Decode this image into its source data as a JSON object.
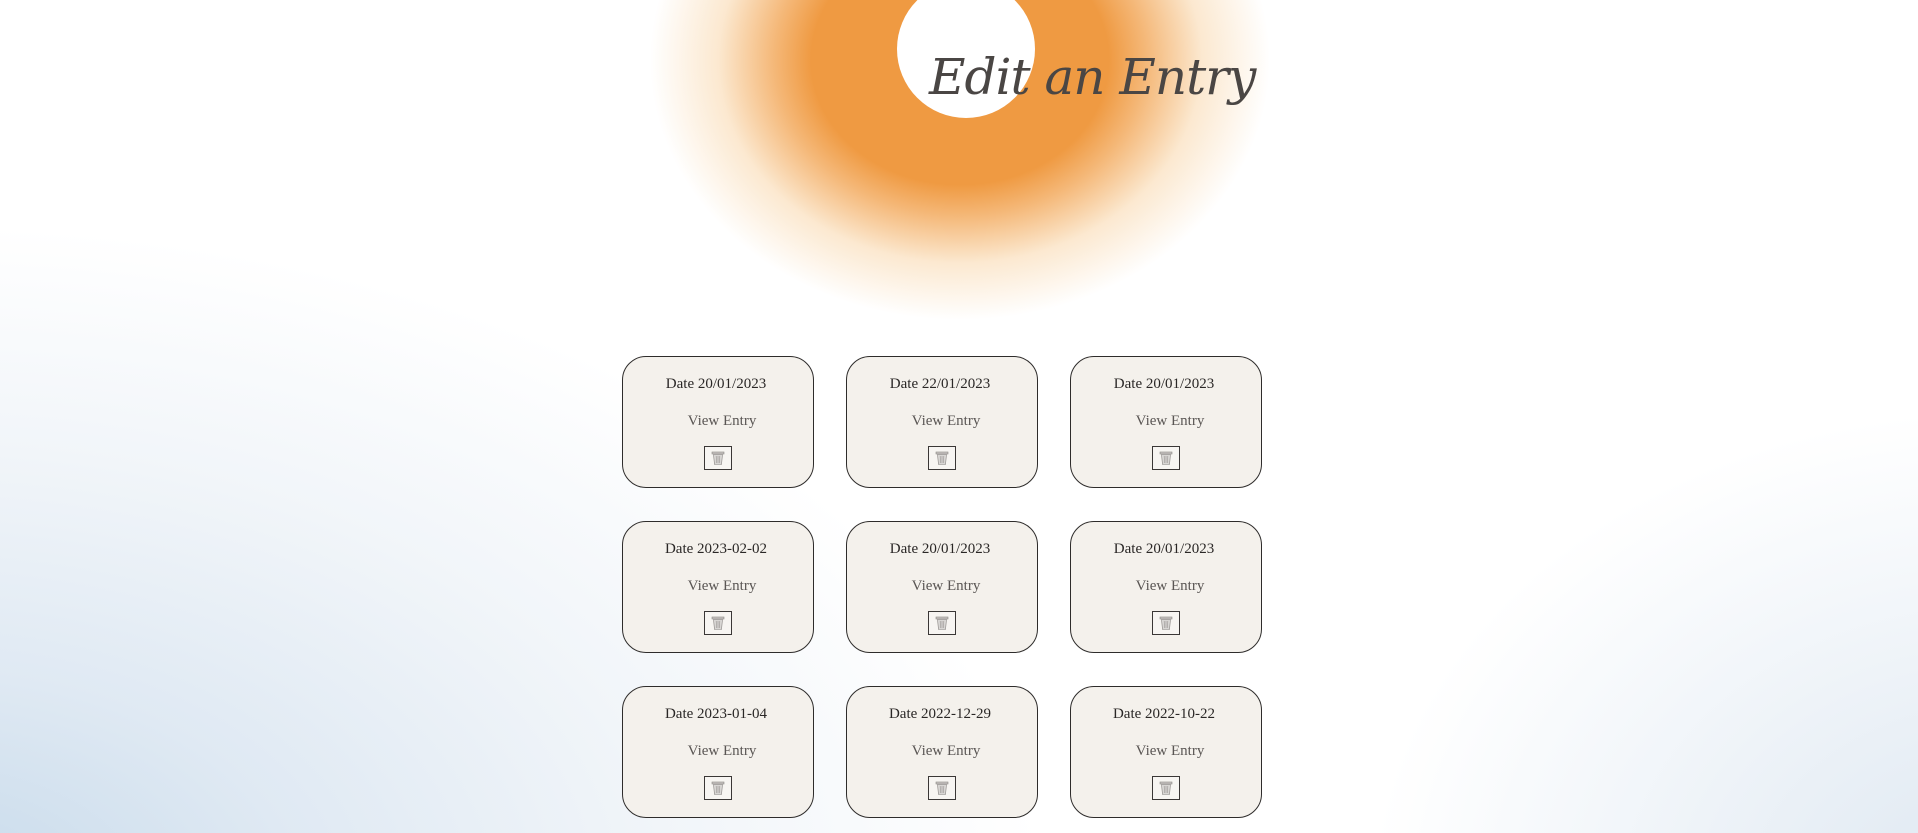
{
  "header": {
    "title": "Edit an Entry"
  },
  "colors": {
    "sun": "#ef9a42",
    "card_background": "#f4f1ec",
    "card_border": "#2e2c2b",
    "title_text": "#4a4644"
  },
  "entries": [
    {
      "date_label": "Date 20/01/2023",
      "view_label": "View Entry",
      "delete_icon": "trash-icon"
    },
    {
      "date_label": "Date 22/01/2023",
      "view_label": "View Entry",
      "delete_icon": "trash-icon"
    },
    {
      "date_label": "Date 20/01/2023",
      "view_label": "View Entry",
      "delete_icon": "trash-icon"
    },
    {
      "date_label": "Date 2023-02-02",
      "view_label": "View Entry",
      "delete_icon": "trash-icon"
    },
    {
      "date_label": "Date 20/01/2023",
      "view_label": "View Entry",
      "delete_icon": "trash-icon"
    },
    {
      "date_label": "Date 20/01/2023",
      "view_label": "View Entry",
      "delete_icon": "trash-icon"
    },
    {
      "date_label": "Date 2023-01-04",
      "view_label": "View Entry",
      "delete_icon": "trash-icon"
    },
    {
      "date_label": "Date 2022-12-29",
      "view_label": "View Entry",
      "delete_icon": "trash-icon"
    },
    {
      "date_label": "Date 2022-10-22",
      "view_label": "View Entry",
      "delete_icon": "trash-icon"
    }
  ]
}
